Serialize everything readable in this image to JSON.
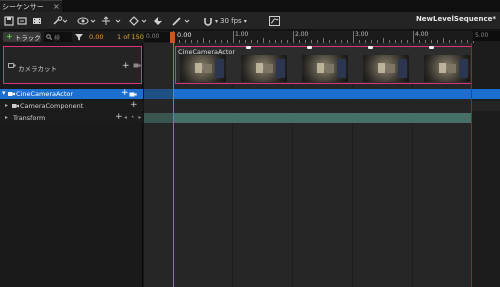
{
  "tab": {
    "title": "シーケンサー",
    "close": "×"
  },
  "toolbar": {
    "fps": "30 fps",
    "level_name": "NewLevelSequence*",
    "icons": [
      "save-icon",
      "browse-icon",
      "film-icon",
      "key-icon",
      "eye-icon",
      "transform-icon",
      "diamond-icon",
      "render-icon",
      "pencil-icon",
      "magnet-icon",
      "curve-icon"
    ]
  },
  "subbar": {
    "add_track": "トラック",
    "search_placeholder": "検",
    "current_time": "0.00",
    "frame_counter": "1 of 150",
    "start_time": "0.00",
    "end_time": "5.00"
  },
  "ruler": {
    "playhead_label": "0.00",
    "labels": [
      "1.00",
      "2.00",
      "3.00",
      "4.00",
      "5.00"
    ]
  },
  "tracks": {
    "camera_cut": {
      "label": "カメラカット",
      "section_label": "CineCameraActor"
    },
    "actor": {
      "label": "CineCameraActor"
    },
    "component": {
      "label": "CameraComponent"
    },
    "transform": {
      "label": "Transform",
      "key_nav": "◂ • ▸"
    }
  },
  "colors": {
    "selection": "#1a6fd0",
    "camera_cut_border": "#d8357a",
    "playhead": "#c05a28",
    "transform_bar": "#466f68",
    "time_text": "#e0a040"
  }
}
